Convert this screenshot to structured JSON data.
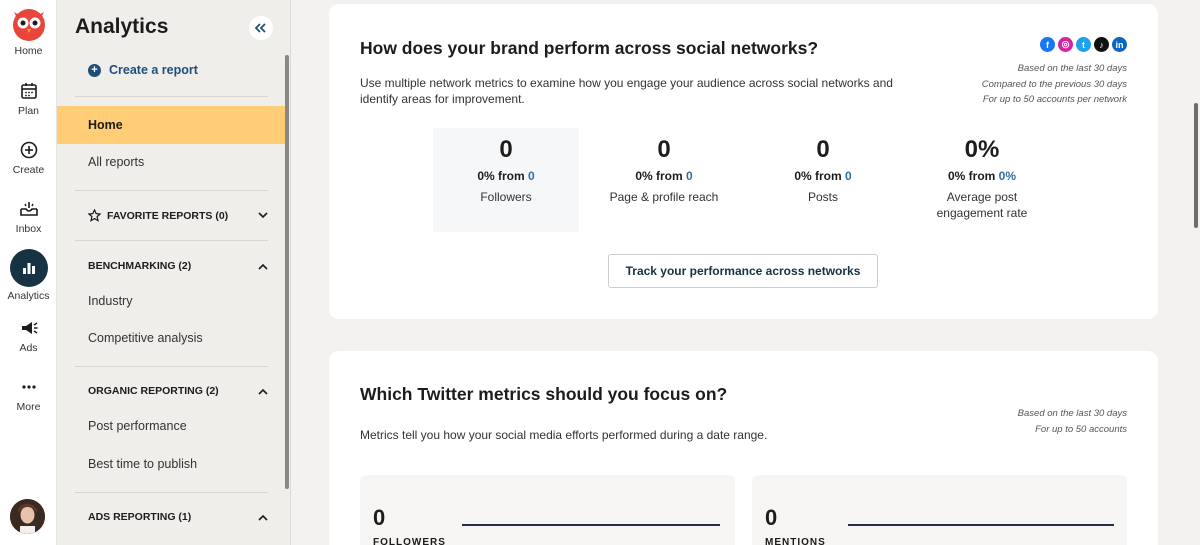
{
  "rail": {
    "items": [
      {
        "label": "Home",
        "icon": "owl-icon"
      },
      {
        "label": "Plan",
        "icon": "calendar-icon"
      },
      {
        "label": "Create",
        "icon": "plus-circle-icon"
      },
      {
        "label": "Inbox",
        "icon": "inbox-icon"
      },
      {
        "label": "Analytics",
        "icon": "bar-chart-icon"
      },
      {
        "label": "Ads",
        "icon": "megaphone-icon"
      },
      {
        "label": "More",
        "icon": "dots-icon"
      }
    ]
  },
  "sidebar": {
    "title": "Analytics",
    "create_label": "Create a report",
    "items": {
      "home": "Home",
      "all_reports": "All reports",
      "industry": "Industry",
      "competitive": "Competitive analysis",
      "post_perf": "Post performance",
      "best_time": "Best time to publish"
    },
    "sections": {
      "favorites": "FAVORITE REPORTS (0)",
      "benchmarking": "BENCHMARKING (2)",
      "organic": "ORGANIC REPORTING (2)",
      "ads": "ADS REPORTING (1)"
    }
  },
  "brand_card": {
    "title": "How does your brand perform across social networks?",
    "description": "Use multiple network metrics to examine how you engage your audience across social networks and identify areas for improvement.",
    "meta": [
      "Based on the last 30 days",
      "Compared to the previous 30 days",
      "For up to 50 accounts per network"
    ],
    "networks": [
      "facebook-icon",
      "instagram-icon",
      "twitter-icon",
      "tiktok-icon",
      "linkedin-icon"
    ],
    "metrics": [
      {
        "value": "0",
        "change_prefix": "0% from",
        "change_value": "0",
        "label": "Followers"
      },
      {
        "value": "0",
        "change_prefix": "0% from",
        "change_value": "0",
        "label": "Page & profile reach"
      },
      {
        "value": "0",
        "change_prefix": "0% from",
        "change_value": "0",
        "label": "Posts"
      },
      {
        "value": "0%",
        "change_prefix": "0% from",
        "change_value": "0%",
        "label": "Average post engagement rate"
      }
    ],
    "button_label": "Track your performance across networks"
  },
  "twitter_card": {
    "title": "Which Twitter metrics should you focus on?",
    "description": "Metrics tell you how your social media efforts performed during a date range.",
    "meta": [
      "Based on the last 30 days",
      "For up to 50 accounts"
    ],
    "tiles": [
      {
        "value": "0",
        "label": "FOLLOWERS"
      },
      {
        "value": "0",
        "label": "MENTIONS"
      }
    ]
  },
  "colors": {
    "accent": "#ffcd76",
    "nav_dark": "#163243",
    "link": "#1f4e79",
    "change_blue": "#2f6fa3"
  }
}
